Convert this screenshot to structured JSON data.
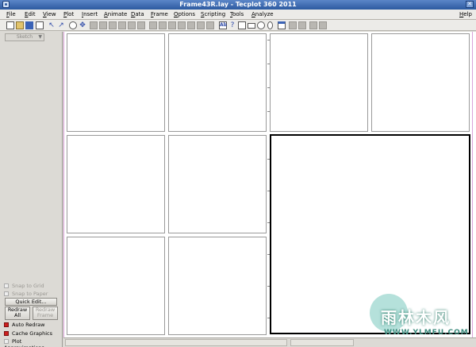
{
  "window": {
    "title": "Frame43R.lay - Tecplot 360 2011",
    "close_glyph": "✕"
  },
  "menu": {
    "items": [
      "File",
      "Edit",
      "View",
      "Plot",
      "Insert",
      "Animate",
      "Data",
      "Frame",
      "Options",
      "Scripting",
      "Tools",
      "Analyze"
    ],
    "help": "Help"
  },
  "toolbar": {
    "text_tool_label": "Ab",
    "help_tool_label": "?"
  },
  "sidebar": {
    "mode_select": "Sketch",
    "snap_to_grid": "Snap to Grid",
    "snap_to_paper": "Snap to Paper",
    "quick_edit": "Quick Edit...",
    "redraw_all": "Redraw\nAll",
    "redraw_frame": "Redraw\nFrame",
    "auto_redraw": "Auto Redraw",
    "cache_graphics": "Cache Graphics",
    "plot_approximations": "Plot Approximations"
  },
  "watermark": {
    "cn": "雨林木风",
    "url": "WWW.YLMFU.COM"
  },
  "colors": {
    "accent_red": "#cc1f1f",
    "title_blue": "#2c5aa0",
    "page_border": "#d9a1d9"
  }
}
